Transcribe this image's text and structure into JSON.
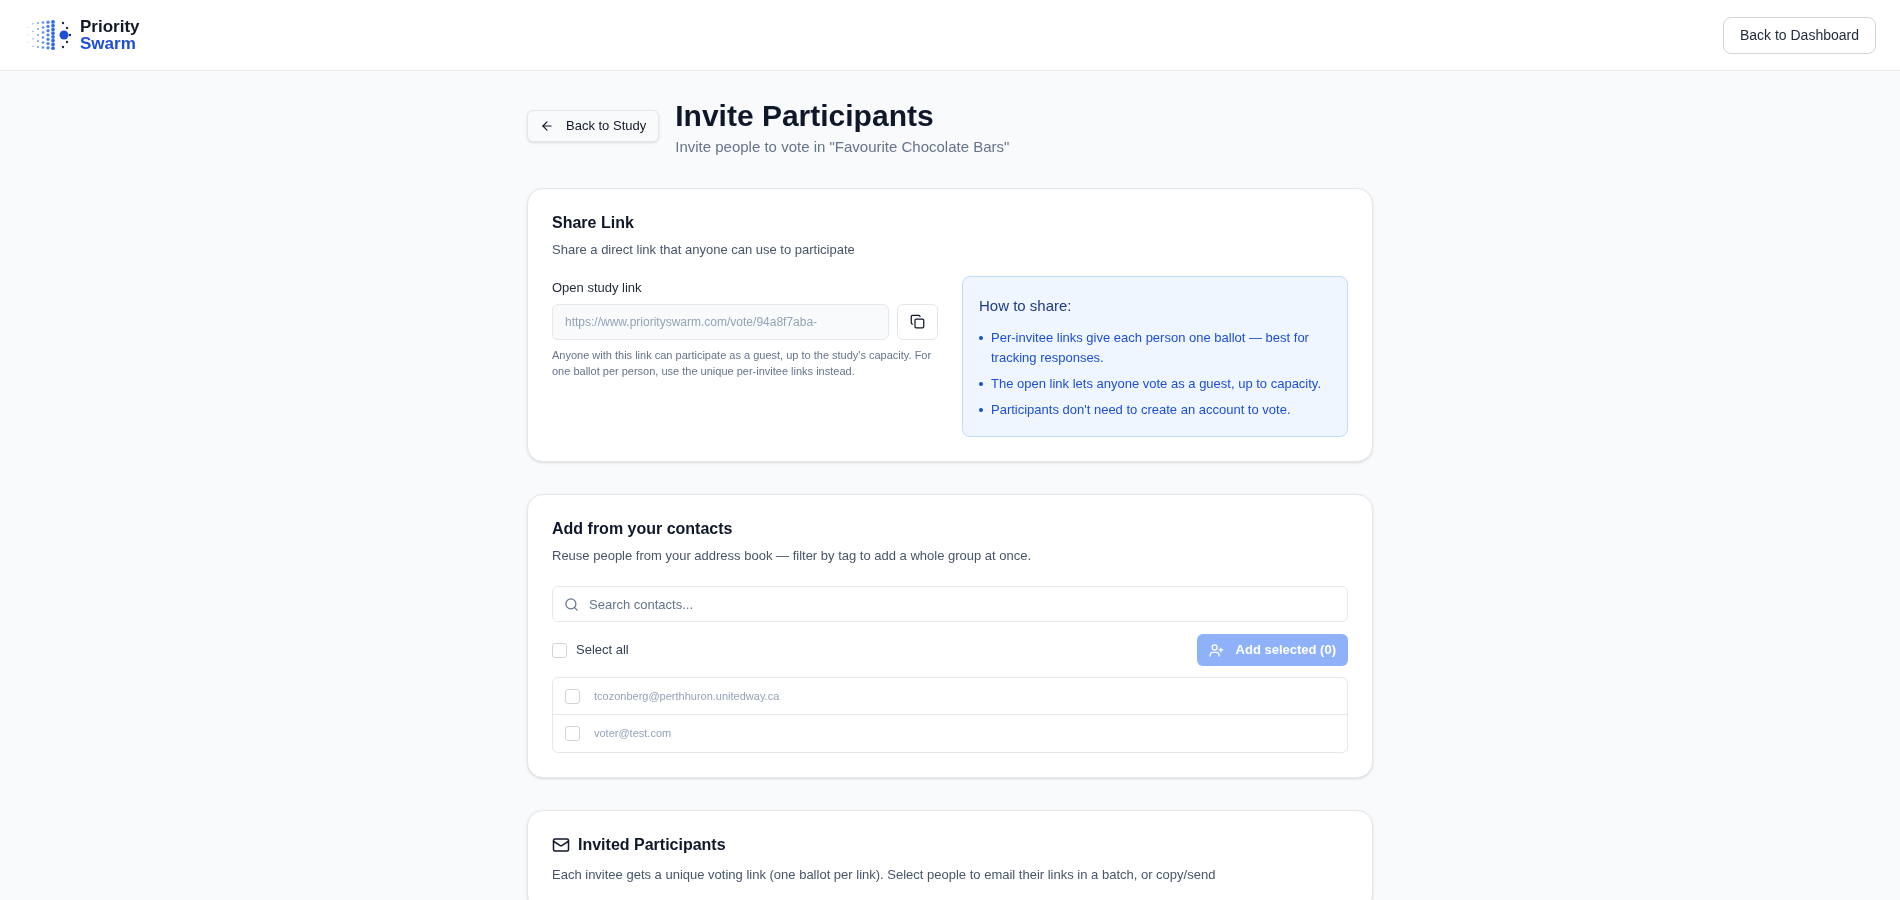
{
  "header": {
    "logo": {
      "line_1": "Priority",
      "line_2": "Swarm"
    },
    "dashboard_button": "Back to Dashboard"
  },
  "page": {
    "back_button": "Back to Study",
    "title": "Invite Participants",
    "subtitle": "Invite people to vote in \"Favourite Chocolate Bars\""
  },
  "share_link": {
    "title": "Share Link",
    "description": "Share a direct link that anyone can use to participate",
    "field_label": "Open study link",
    "link_value": "https://www.priorityswarm.com/vote/94a8f7aba-",
    "help": "Anyone with this link can participate as a guest, up to the study's capacity. For one ballot per person, use the unique per-invitee links instead.",
    "how_to": {
      "title": "How to share:",
      "items": [
        "Per-invitee links give each person one ballot — best for tracking responses.",
        "The open link lets anyone vote as a guest, up to capacity.",
        "Participants don't need to create an account to vote."
      ]
    }
  },
  "contacts": {
    "title": "Add from your contacts",
    "description": "Reuse people from your address book — filter by tag to add a whole group at once.",
    "search": {
      "placeholder": "Search contacts..."
    },
    "select_all": {
      "label": "Select all",
      "checked": false
    },
    "add_button": {
      "label": "Add selected (0)",
      "disabled": true
    },
    "rows": [
      {
        "email": "tcozonberg@perthhuron.unitedway.ca",
        "checked": false
      },
      {
        "email": "voter@test.com",
        "checked": false
      }
    ]
  },
  "invited": {
    "title": "Invited Participants",
    "description": "Each invitee gets a unique voting link (one ballot per link). Select people to email their links in a batch, or copy/send"
  }
}
